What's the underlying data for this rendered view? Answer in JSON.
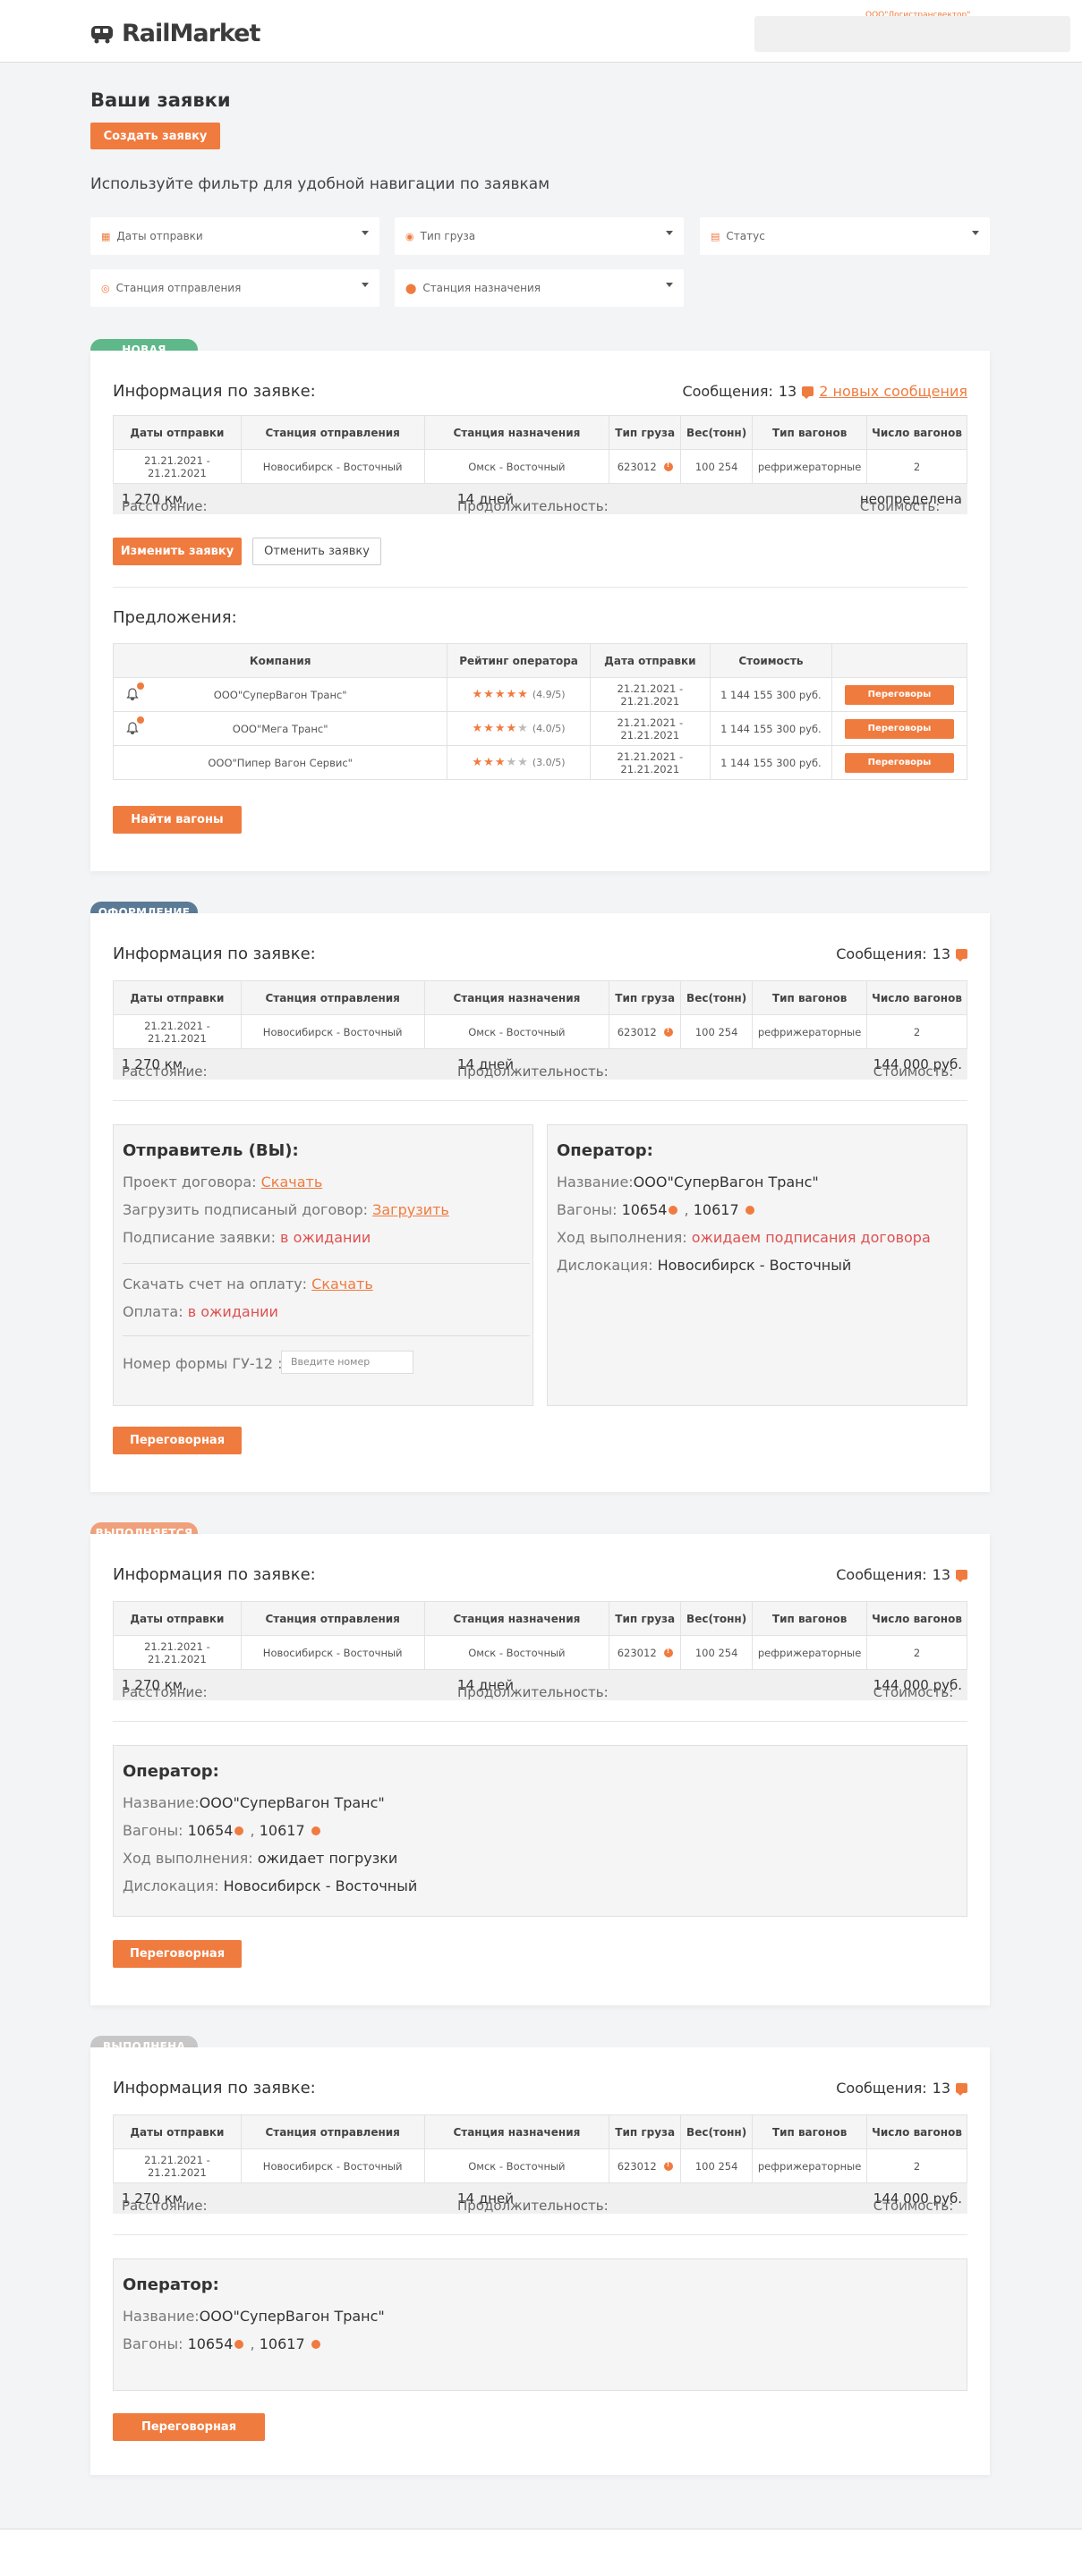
{
  "header": {
    "logo_text": "RailMarket",
    "company_link": "ООО\"Логистрансвектор\""
  },
  "page": {
    "title": "Ваши заявки",
    "create_button": "Создать заявку",
    "filter_hint": "Используйте фильтр для удобной навигации по заявкам"
  },
  "filters": {
    "dates": "Даты отправки",
    "cargo": "Тип груза",
    "status": "Статус",
    "from": "Станция отправления",
    "to": "Станция назначения"
  },
  "table_headers": [
    "Даты отправки",
    "Станция отправления",
    "Станция назначения",
    "Тип груза",
    "Вес(тонн)",
    "Тип вагонов",
    "Число вагонов"
  ],
  "table_row": {
    "dates": "21.21.2021 - 21.21.2021",
    "from": "Новосибирск - Восточный",
    "to": "Омск - Восточный",
    "cargo": "623012",
    "weight": "100 254",
    "wagon_type": "рефрижераторные",
    "count": "2"
  },
  "labels": {
    "info": "Информация по заявке:",
    "messages": "Сообщения:",
    "distance": "Расстояние:",
    "duration": "Продолжительность:",
    "cost": "Стоимость:",
    "distance_val": "1 270 км.",
    "duration_val": "14 дней"
  },
  "card1": {
    "badge": "НОВАЯ",
    "msg_count": "13",
    "new_msgs": "2 новых сообщения",
    "cost_val": "неопределена",
    "edit_button": "Изменить заявку",
    "cancel_button": "Отменить заявку",
    "offers_title": "Предложения:",
    "offer_headers": [
      "Компания",
      "Рейтинг оператора",
      "Дата отправки",
      "Стоимость"
    ],
    "offers": [
      {
        "company": "ООО\"СуперВагон Транс\"",
        "rating": "(4.9/5)",
        "date": "21.21.2021 - 21.21.2021",
        "price": "1 144 155 300 руб.",
        "button": "Переговоры"
      },
      {
        "company": "ООО\"Мега Транс\"",
        "rating": "(4.0/5)",
        "date": "21.21.2021 - 21.21.2021",
        "price": "1 144 155 300 руб.",
        "button": "Переговоры"
      },
      {
        "company": "ООО\"Пипер Вагон Сервис\"",
        "rating": "(3.0/5)",
        "date": "21.21.2021 - 21.21.2021",
        "price": "1 144 155 300 руб.",
        "button": "Переговоры"
      }
    ],
    "find_button": "Найти вагоны"
  },
  "card2": {
    "badge": "ОФОРМЛЕНИЕ",
    "msg_count": "13",
    "cost_val": "144 000 руб.",
    "sender_title": "Отправитель (ВЫ):",
    "contract_label": "Проект договора:",
    "contract_link": "Скачать",
    "upload_label": "Загрузить подписаный договор:",
    "upload_link": "Загрузить",
    "sign_label": "Подписание заявки:",
    "sign_status": "в ожидании",
    "invoice_label": "Скачать счет на оплату:",
    "invoice_link": "Скачать",
    "payment_label": "Оплата:",
    "payment_status": "в ожидании",
    "gu_label": "Номер формы ГУ-12 :",
    "gu_placeholder": "Введите номер",
    "operator_title": "Оператор:",
    "name_label": "Название:",
    "name_val": "ООО\"СуперВагон Транс\"",
    "wagons_label": "Вагоны:",
    "wagon1": "10654",
    "wagon2": "10617",
    "progress_label": "Ход выполнения:",
    "progress_val": "ожидаем подписания договора",
    "location_label": "Дислокация:",
    "location_val": "Новосибирск - Восточный",
    "button": "Переговорная"
  },
  "card3": {
    "badge": "ВЫПОЛНЯЕТСЯ",
    "msg_count": "13",
    "cost_val": "144 000 руб.",
    "operator_title": "Оператор:",
    "name_label": "Название:",
    "name_val": "ООО\"СуперВагон Транс\"",
    "wagons_label": "Вагоны:",
    "wagon1": "10654",
    "wagon2": "10617",
    "progress_label": "Ход выполнения:",
    "progress_val": "ожидает погрузки",
    "location_label": "Дислокация:",
    "location_val": "Новосибирск - Восточный",
    "button": "Переговорная"
  },
  "card4": {
    "badge": "ВЫПОЛНЕНА",
    "msg_count": "13",
    "cost_val": "144 000 руб.",
    "operator_title": "Оператор:",
    "name_label": "Название:",
    "name_val": "ООО\"СуперВагон Транс\"",
    "wagons_label": "Вагоны:",
    "wagon1": "10654",
    "wagon2": "10617",
    "button": "Переговорная"
  },
  "colors": {
    "accent": "#f07b3f",
    "badge_new": "#5fb88a",
    "badge_processing": "#5b7a96",
    "badge_running": "#f0a07a",
    "badge_done": "#c7c7c7"
  }
}
